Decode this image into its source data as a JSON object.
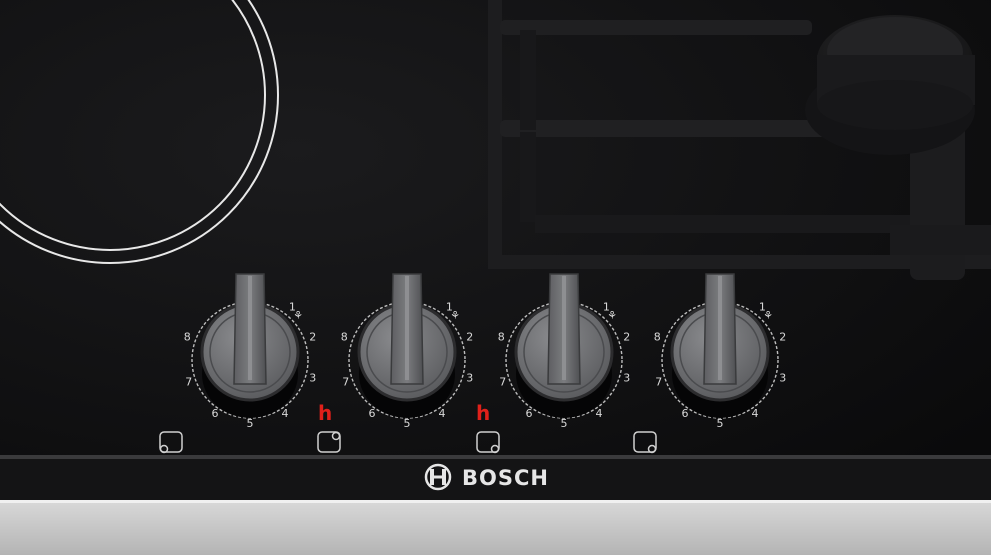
{
  "brand": {
    "name": "BOSCH"
  },
  "hob": {
    "heat_indicator": "h",
    "knobs": [
      {
        "id": "knob-1",
        "dial": [
          "1",
          "2",
          "3",
          "4",
          "5",
          "6",
          "7",
          "8"
        ],
        "zone_icon": "zone-front-left-icon"
      },
      {
        "id": "knob-2",
        "dial": [
          "1",
          "2",
          "3",
          "4",
          "5",
          "6",
          "7",
          "8"
        ],
        "zone_icon": "zone-front-right-icon"
      },
      {
        "id": "knob-3",
        "dial": [
          "1",
          "2",
          "3",
          "4",
          "5",
          "6",
          "7",
          "8"
        ],
        "zone_icon": "zone-rear-right-icon"
      },
      {
        "id": "knob-4",
        "dial": [
          "1",
          "2",
          "3",
          "4",
          "5",
          "6",
          "7",
          "8"
        ],
        "zone_icon": "zone-rear-left-icon"
      }
    ]
  },
  "colors": {
    "glass": "#0c0c0d",
    "frame": "#1a1a1b",
    "steel": "#c9c9c9",
    "knob": "#6d6e70",
    "indicator": "#e0201a"
  }
}
